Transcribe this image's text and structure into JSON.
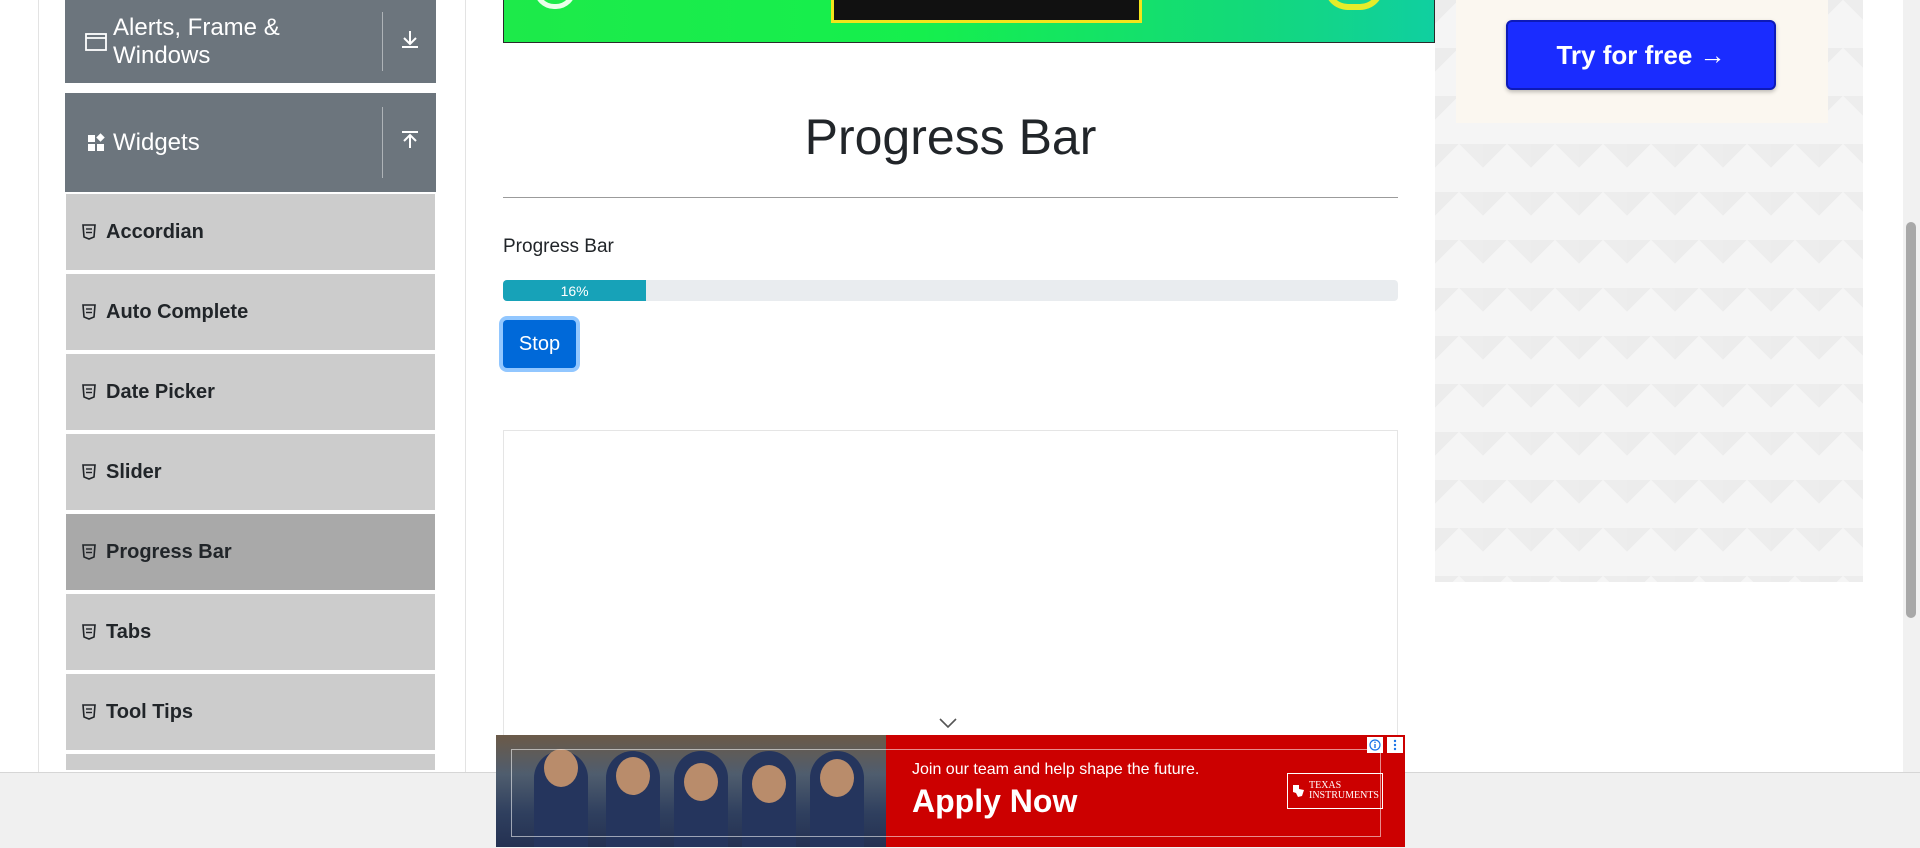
{
  "sidebar": {
    "groups": [
      {
        "label": "Alerts, Frame & Windows",
        "state": "collapsed"
      },
      {
        "label": "Widgets",
        "state": "expanded"
      }
    ],
    "items": [
      {
        "label": "Accordian"
      },
      {
        "label": "Auto Complete"
      },
      {
        "label": "Date Picker"
      },
      {
        "label": "Slider"
      },
      {
        "label": "Progress Bar",
        "active": true
      },
      {
        "label": "Tabs"
      },
      {
        "label": "Tool Tips"
      }
    ]
  },
  "main": {
    "title": "Progress Bar",
    "progress": {
      "label": "Progress Bar",
      "value": 16,
      "text": "16%",
      "color": "#17a2b8"
    },
    "stop_button": "Stop"
  },
  "right_ad": {
    "cta": "Try for free →",
    "cta_color": "#1a2cff"
  },
  "bottom_ad": {
    "subtitle": "Join our team and help shape the future.",
    "cta": "Apply Now",
    "brand_line1": "TEXAS",
    "brand_line2": "INSTRUMENTS",
    "bg_color": "#cc0000"
  }
}
